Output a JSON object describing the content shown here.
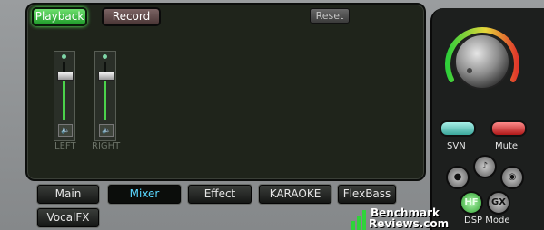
{
  "mixer": {
    "playback_label": "Playback",
    "record_label": "Record",
    "reset_label": "Reset",
    "left_label": "LEFT",
    "right_label": "RIGHT",
    "left_level": 0.78,
    "right_level": 0.78
  },
  "tabs": [
    {
      "label": "Main"
    },
    {
      "label": "Mixer",
      "active": true
    },
    {
      "label": "Effect"
    },
    {
      "label": "KARAOKE"
    },
    {
      "label": "FlexBass"
    },
    {
      "label": "VocalFX"
    }
  ],
  "side": {
    "svn_label": "SVN",
    "mute_label": "Mute",
    "dsp_label": "DSP Mode",
    "dsp_buttons": [
      {
        "name": "game-mode-icon"
      },
      {
        "name": "music-mode-icon"
      },
      {
        "name": "movie-mode-icon"
      },
      {
        "name": "hifi-mode-icon",
        "text": "HF"
      },
      {
        "name": "gx-mode-icon",
        "text": "GX"
      }
    ]
  },
  "watermark": {
    "line1": "Benchmark",
    "line2": "Reviews.com"
  }
}
